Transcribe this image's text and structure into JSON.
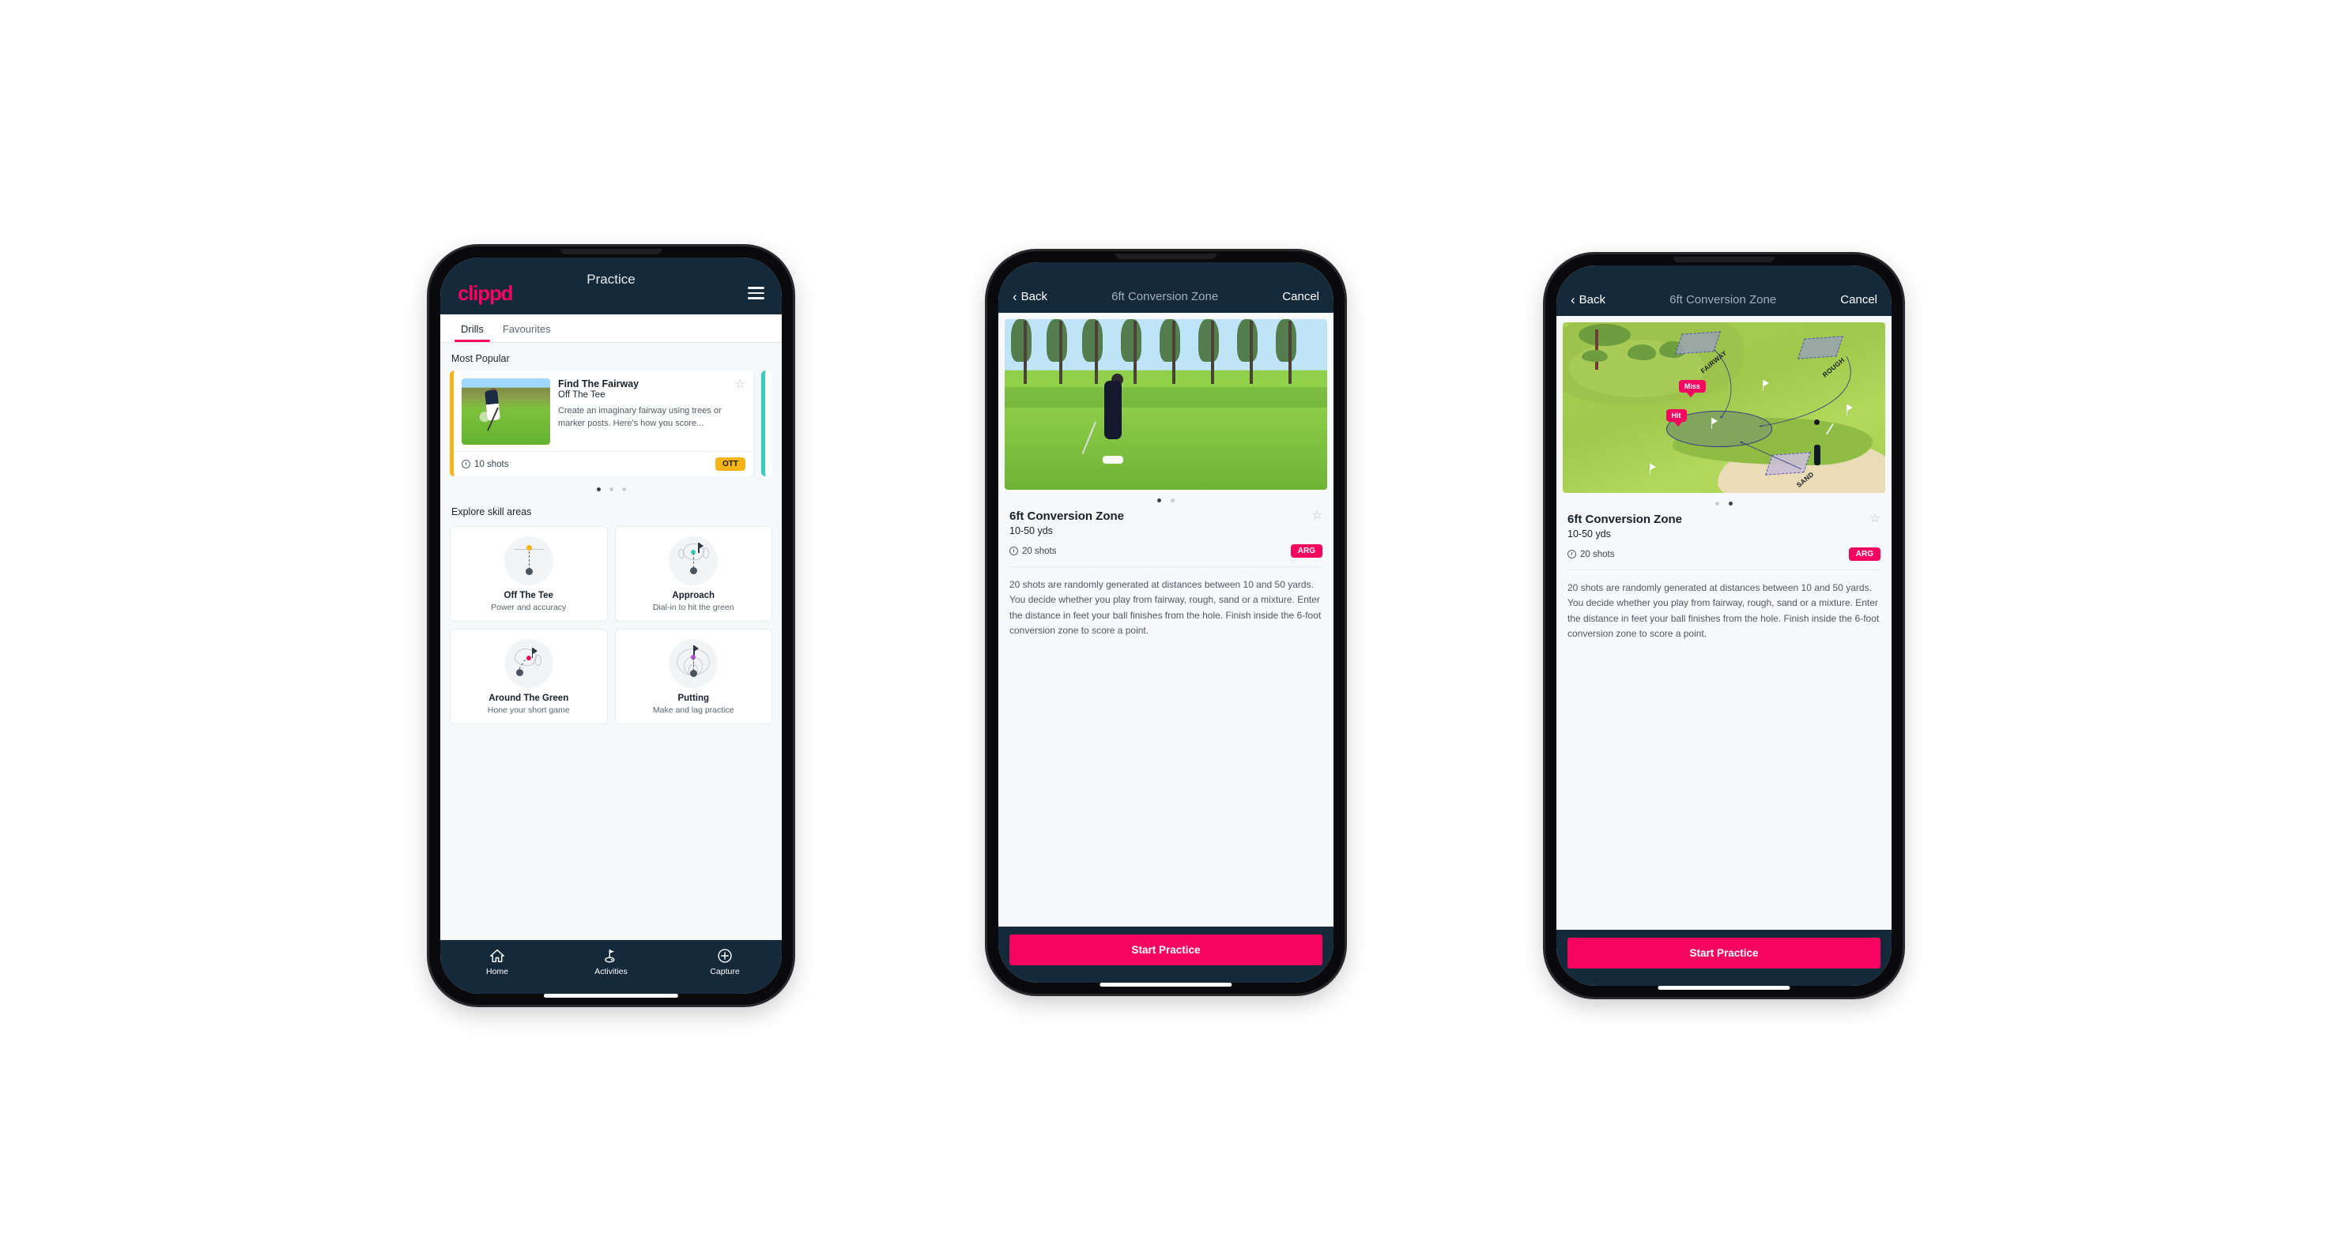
{
  "phone1": {
    "appbar": {
      "logo": "clippd",
      "title": "Practice",
      "menu_icon": "hamburger-icon"
    },
    "tabs": [
      {
        "label": "Drills",
        "active": true
      },
      {
        "label": "Favourites",
        "active": false
      }
    ],
    "sections": {
      "most_popular": "Most Popular",
      "explore": "Explore skill areas"
    },
    "popular_card": {
      "title": "Find The Fairway",
      "subtitle": "Off The Tee",
      "description": "Create an imaginary fairway using trees or marker posts. Here's how you score...",
      "shots": "10 shots",
      "badge": "OTT",
      "badge_color": "#f5b518",
      "accent_color": "#f5b518",
      "star_icon": "star-outline-icon"
    },
    "carousel_dots": 3,
    "carousel_active": 0,
    "skills": [
      {
        "name": "Off The Tee",
        "desc": "Power and accuracy",
        "icon": "tee-fan-icon",
        "accent": "#f5b518"
      },
      {
        "name": "Approach",
        "desc": "Dial-in to hit the green",
        "icon": "approach-green-icon",
        "accent": "#2ed1bd"
      },
      {
        "name": "Around The Green",
        "desc": "Hone your short game",
        "icon": "short-game-icon",
        "accent": "#f5055f"
      },
      {
        "name": "Putting",
        "desc": "Make and lag practice",
        "icon": "putting-rings-icon",
        "accent": "#b34bd6"
      }
    ],
    "bottom_nav": [
      {
        "label": "Home",
        "icon": "home-icon",
        "active": false
      },
      {
        "label": "Activities",
        "icon": "golf-flag-icon",
        "active": true
      },
      {
        "label": "Capture",
        "icon": "plus-circle-icon",
        "active": false
      }
    ]
  },
  "phone2": {
    "navbar": {
      "back": "Back",
      "title": "6ft Conversion Zone",
      "cancel": "Cancel",
      "back_icon": "chevron-left-icon"
    },
    "media": {
      "type": "photo",
      "alt": "golfer-chipping-photo"
    },
    "dots": 2,
    "dots_active": 0,
    "detail": {
      "title": "6ft Conversion Zone",
      "subtitle": "10-50 yds",
      "shots": "20 shots",
      "badge": "ARG",
      "badge_color": "#f5055f",
      "star_icon": "star-outline-icon",
      "description": "20 shots are randomly generated at distances between 10 and 50 yards. You decide whether you play from fairway, rough, sand or a mixture. Enter the distance in feet your ball finishes from the hole. Finish inside the 6-foot conversion zone to score a point."
    },
    "cta": "Start Practice"
  },
  "phone3": {
    "navbar": {
      "back": "Back",
      "title": "6ft Conversion Zone",
      "cancel": "Cancel",
      "back_icon": "chevron-left-icon"
    },
    "media": {
      "type": "illustration",
      "alt": "golf-hole-diagram",
      "zone_labels": [
        "FAIRWAY",
        "ROUGH",
        "SAND"
      ],
      "markers": [
        {
          "label": "Miss",
          "color": "#f5055f"
        },
        {
          "label": "Hit",
          "color": "#f5055f"
        }
      ]
    },
    "dots": 2,
    "dots_active": 1,
    "detail": {
      "title": "6ft Conversion Zone",
      "subtitle": "10-50 yds",
      "shots": "20 shots",
      "badge": "ARG",
      "badge_color": "#f5055f",
      "star_icon": "star-outline-icon",
      "description": "20 shots are randomly generated at distances between 10 and 50 yards. You decide whether you play from fairway, rough, sand or a mixture. Enter the distance in feet your ball finishes from the hole. Finish inside the 6-foot conversion zone to score a point."
    },
    "cta": "Start Practice"
  }
}
